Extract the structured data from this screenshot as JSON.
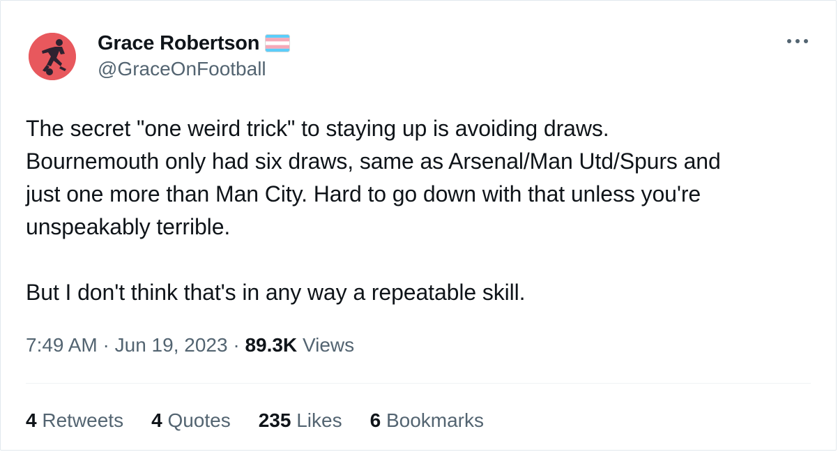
{
  "author": {
    "display_name": "Grace Robertson",
    "handle": "@GraceOnFootball",
    "avatar_icon": "footballer-silhouette-icon",
    "flag_icon": "transgender-flag-icon"
  },
  "tweet": {
    "lines": [
      "The secret \"one weird trick\" to staying up is avoiding draws.",
      "Bournemouth only had six draws, same as Arsenal/Man Utd/Spurs and",
      "just one more than Man City. Hard to go down with that unless you're",
      "unspeakably terrible."
    ],
    "paragraph2": "But I don't think that's in any way a repeatable skill."
  },
  "meta": {
    "time": "7:49 AM",
    "separator": "·",
    "date": "Jun 19, 2023",
    "views_count": "89.3K",
    "views_label": "Views"
  },
  "stats": {
    "retweets": {
      "count": "4",
      "label": "Retweets"
    },
    "quotes": {
      "count": "4",
      "label": "Quotes"
    },
    "likes": {
      "count": "235",
      "label": "Likes"
    },
    "bookmarks": {
      "count": "6",
      "label": "Bookmarks"
    }
  },
  "colors": {
    "text": "#0f1419",
    "secondary": "#536471",
    "avatar_bg": "#e8585d",
    "flag_blue": "#5bcefa",
    "flag_pink": "#f5a9b8",
    "divider": "#eff3f4"
  }
}
